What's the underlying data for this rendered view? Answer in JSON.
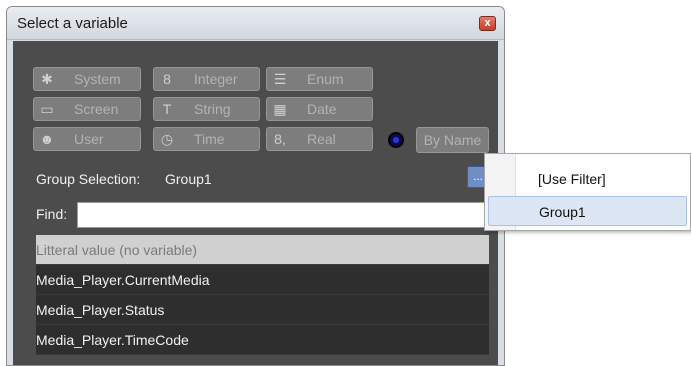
{
  "window": {
    "title": "Select a variable",
    "close_symbol": "x"
  },
  "type_buttons": [
    {
      "label": "System",
      "icon": "gear-icon",
      "glyph": "✱"
    },
    {
      "label": "Integer",
      "icon": "integer-icon",
      "glyph": "8"
    },
    {
      "label": "Enum",
      "icon": "list-icon",
      "glyph": "☰"
    },
    {
      "label": "Screen",
      "icon": "screen-icon",
      "glyph": "▭"
    },
    {
      "label": "String",
      "icon": "text-icon",
      "glyph": "T"
    },
    {
      "label": "Date",
      "icon": "calendar-icon",
      "glyph": "▦"
    },
    {
      "label": "User",
      "icon": "user-icon",
      "glyph": "☻"
    },
    {
      "label": "Time",
      "icon": "clock-icon",
      "glyph": "◷"
    },
    {
      "label": "Real",
      "icon": "real-icon",
      "glyph": "8,"
    }
  ],
  "by_name_label": "By Name",
  "group": {
    "label": "Group Selection:",
    "value": "Group1",
    "button_label": "..."
  },
  "find": {
    "label": "Find:",
    "value": ""
  },
  "variables": [
    "Litteral value (no variable)",
    "Media_Player.CurrentMedia",
    "Media_Player.Status",
    "Media_Player.TimeCode"
  ],
  "dropdown": {
    "items": [
      "[Use Filter]",
      "Group1"
    ]
  }
}
